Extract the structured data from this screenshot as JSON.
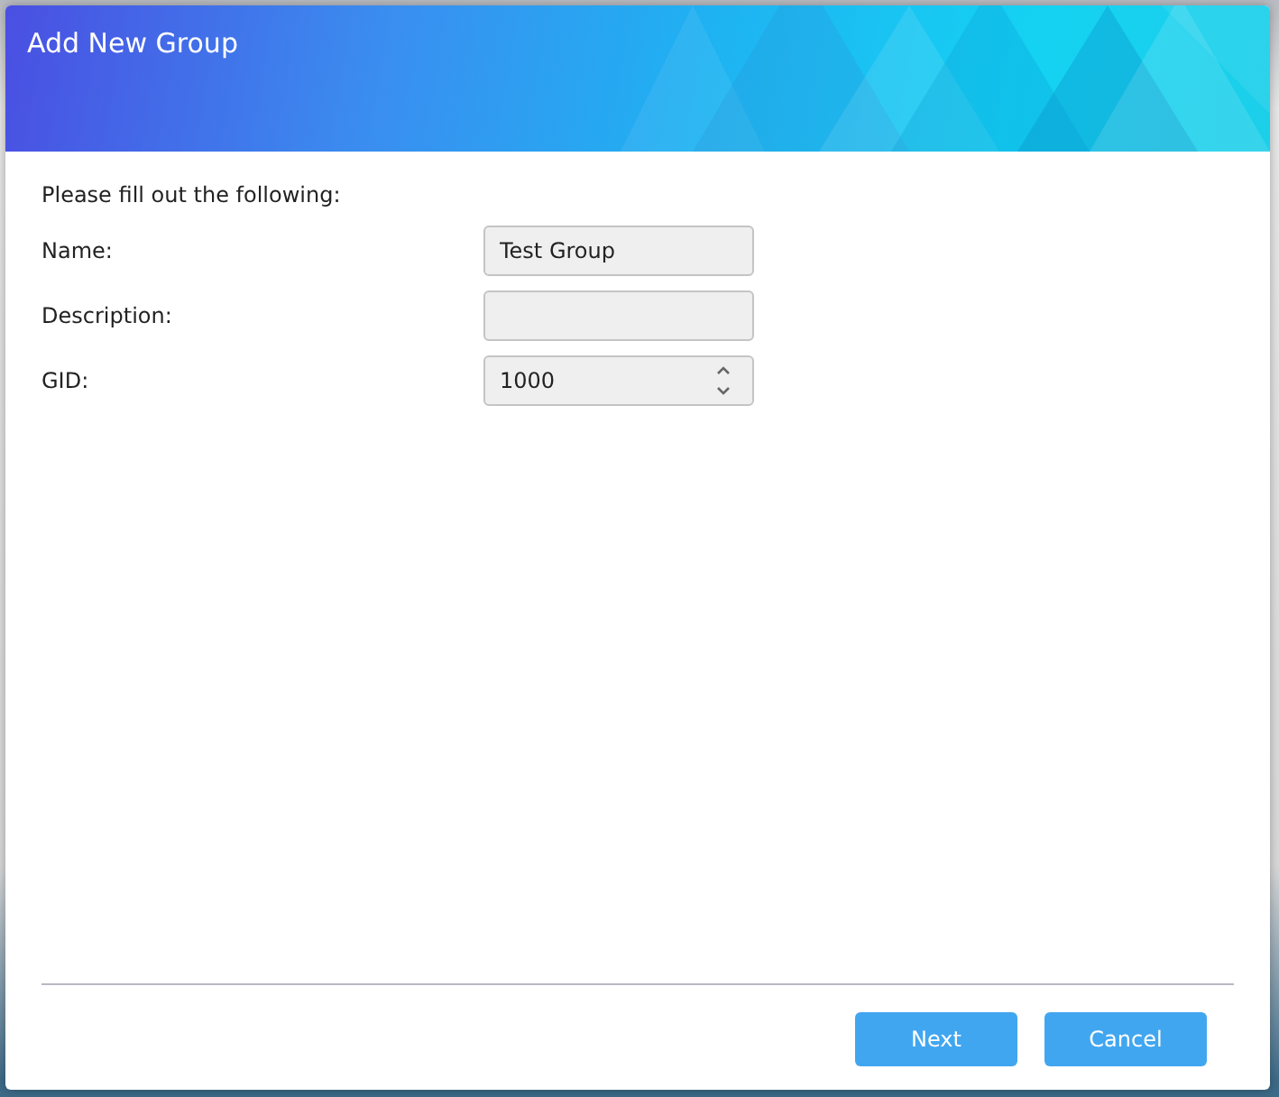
{
  "dialog": {
    "title": "Add New Group",
    "instruction": "Please fill out the following:",
    "fields": [
      {
        "kind": "text",
        "label": "Name:",
        "value": "Test Group"
      },
      {
        "kind": "text",
        "label": "Description:"
      },
      {
        "kind": "number",
        "label": "GID:",
        "value": "1000"
      }
    ],
    "buttons": [
      "Next",
      "Cancel"
    ]
  }
}
